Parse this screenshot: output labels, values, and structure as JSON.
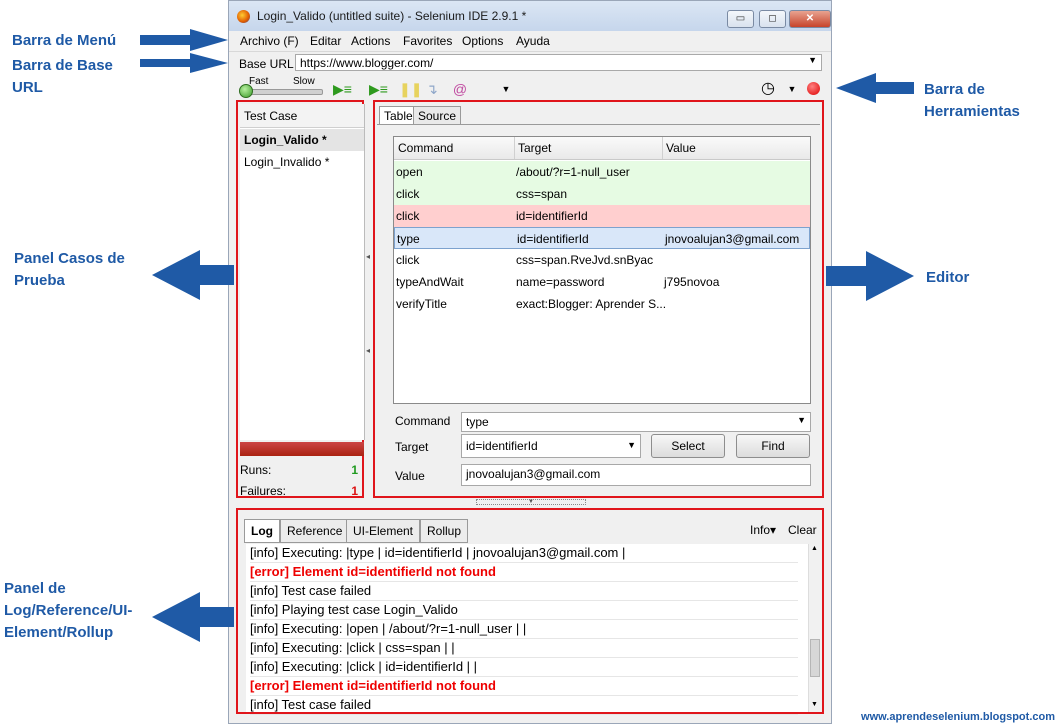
{
  "window": {
    "title": "Login_Valido (untitled suite) - Selenium IDE 2.9.1 *",
    "controls": {
      "minimize": "▭",
      "maximize": "◻",
      "close": "✕"
    }
  },
  "menu": {
    "items": [
      "Archivo (F)",
      "Editar",
      "Actions",
      "Favorites",
      "Options",
      "Ayuda"
    ]
  },
  "base_url": {
    "label": "Base URL",
    "value": "https://www.blogger.com/"
  },
  "toolbar": {
    "speed_fast": "Fast",
    "speed_slow": "Slow",
    "icons": [
      "play-suite-icon",
      "play-test-icon",
      "pause-icon",
      "step-icon",
      "rollup-icon",
      "clock-icon",
      "record-icon"
    ]
  },
  "test_cases": {
    "header": "Test Case",
    "items": [
      "Login_Valido *",
      "Login_Invalido *"
    ],
    "runs_label": "Runs:",
    "runs_value": "1",
    "failures_label": "Failures:",
    "failures_value": "1"
  },
  "editor": {
    "tabs": [
      "Table",
      "Source"
    ],
    "columns": [
      "Command",
      "Target",
      "Value"
    ],
    "rows": [
      {
        "command": "open",
        "target": "/about/?r=1-null_user",
        "value": "",
        "status": "pass"
      },
      {
        "command": "click",
        "target": "css=span",
        "value": "",
        "status": "pass"
      },
      {
        "command": "click",
        "target": "id=identifierId",
        "value": "",
        "status": "fail"
      },
      {
        "command": "type",
        "target": "id=identifierId",
        "value": "jnovoalujan3@gmail.com",
        "status": "selected"
      },
      {
        "command": "click",
        "target": "css=span.RveJvd.snByac",
        "value": "",
        "status": ""
      },
      {
        "command": "typeAndWait",
        "target": "name=password",
        "value": "j795novoa",
        "status": ""
      },
      {
        "command": "verifyTitle",
        "target": "exact:Blogger: Aprender S...",
        "value": "",
        "status": ""
      }
    ],
    "command_label": "Command",
    "command_value": "type",
    "target_label": "Target",
    "target_value": "id=identifierId",
    "value_label": "Value",
    "value_value": "jnovoalujan3@gmail.com",
    "select_button": "Select",
    "find_button": "Find"
  },
  "log": {
    "tabs": [
      "Log",
      "Reference",
      "UI-Element",
      "Rollup"
    ],
    "info_menu": "Info▾",
    "clear": "Clear",
    "lines": [
      {
        "text": "[info] Executing: |type | id=identifierId | jnovoalujan3@gmail.com |",
        "level": "info"
      },
      {
        "text": "[error] Element id=identifierId not found",
        "level": "error"
      },
      {
        "text": "[info] Test case failed",
        "level": "info"
      },
      {
        "text": "[info] Playing test case Login_Valido",
        "level": "info"
      },
      {
        "text": "[info] Executing: |open | /about/?r=1-null_user | |",
        "level": "info"
      },
      {
        "text": "[info] Executing: |click | css=span | |",
        "level": "info"
      },
      {
        "text": "[info] Executing: |click | id=identifierId | |",
        "level": "info"
      },
      {
        "text": "[error] Element id=identifierId not found",
        "level": "error"
      },
      {
        "text": "[info] Test case failed",
        "level": "info"
      }
    ]
  },
  "annotations": {
    "menu_bar": "Barra de Menú",
    "base_url_bar_1": "Barra de Base",
    "base_url_bar_2": "URL",
    "toolbar_1": "Barra de",
    "toolbar_2": "Herramientas",
    "test_case_panel_1": "Panel Casos de",
    "test_case_panel_2": "Prueba",
    "editor": "Editor",
    "log_panel_1": "Panel de",
    "log_panel_2": "Log/Reference/UI-",
    "log_panel_3": "Element/Rollup"
  },
  "footer": "www.aprendeselenium.blogspot.com",
  "colors": {
    "annotation": "#1f5aa6",
    "highlight_box": "#e0151b",
    "pass_row": "#e6fbe3",
    "fail_row": "#ffcfcf",
    "error_text": "#e00000"
  }
}
